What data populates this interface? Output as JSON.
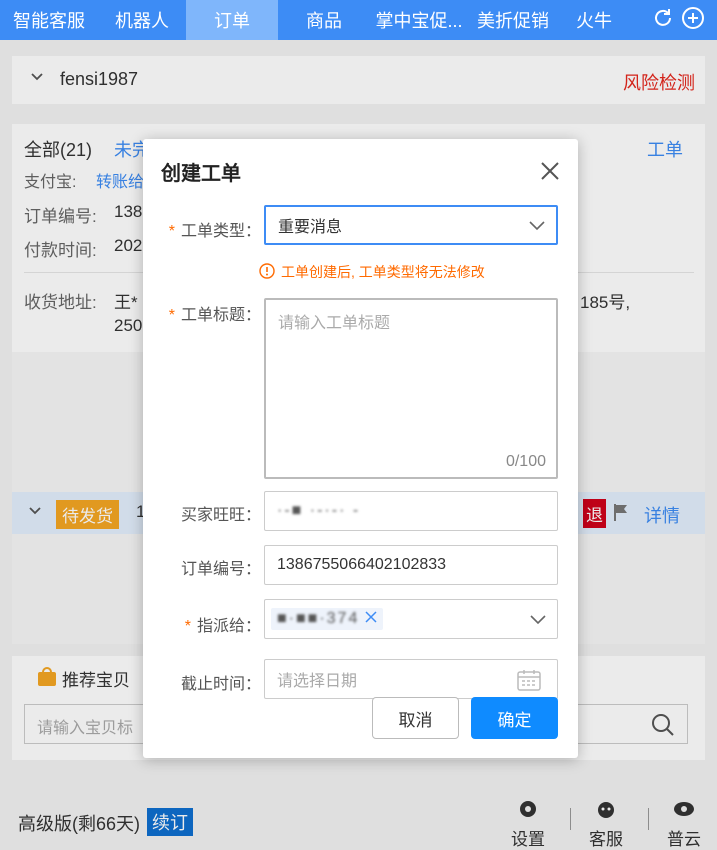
{
  "nav": {
    "tabs": [
      "智能客服",
      "机器人",
      "订单",
      "商品",
      "掌中宝促...",
      "美折促销",
      "火牛"
    ],
    "active_index": 2
  },
  "bg": {
    "account_name": "fensi1987",
    "risk_check": "风险检测",
    "tab_all": "全部(21)",
    "tab_unfinished": "未完",
    "work_order": "工单",
    "alipay_label": "支付宝:",
    "alipay_value": "转账给",
    "order_no_label": "订单编号:",
    "order_no_value": "138",
    "pay_time_label": "付款时间:",
    "pay_time_value": "202",
    "address_label": "收货地址:",
    "address_value": "王*",
    "address_value2": "250",
    "address_tail": "185号,",
    "pending_badge": "待发货",
    "pending_num": "1",
    "refund": "退",
    "details": "详情",
    "recommend_title": "推荐宝贝",
    "recommend_placeholder": "请输入宝贝标",
    "version": "高级版(剩66天)",
    "renew": "续订",
    "footer": [
      "设置",
      "客服",
      "普云"
    ]
  },
  "modal": {
    "title": "创建工单",
    "type_label": "工单类型",
    "type_value": "重要消息",
    "warning": "工单创建后, 工单类型将无法修改",
    "title_label": "工单标题",
    "title_placeholder": "请输入工单标题",
    "title_count": "0/100",
    "buyer_label": "买家旺旺",
    "buyer_value": "·-■ ·-·-· -",
    "order_label": "订单编号",
    "order_value": "1386755066402102833",
    "assign_label": "指派给",
    "assign_value": "■·■■·374",
    "deadline_label": "截止时间",
    "deadline_placeholder": "请选择日期",
    "cancel": "取消",
    "confirm": "确定"
  }
}
